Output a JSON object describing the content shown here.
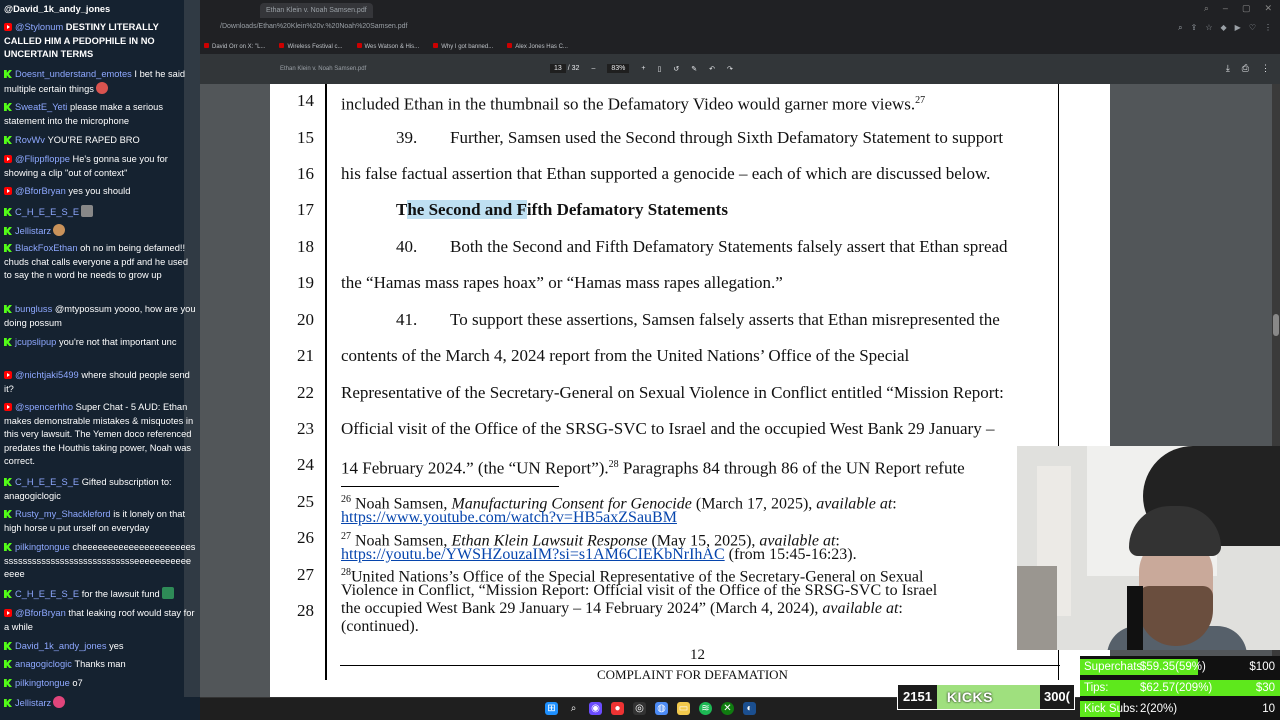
{
  "browser": {
    "tab_title": "Ethan Klein v. Noah Samsen.pdf",
    "url": "/Downloads/Ethan%20Klein%20v.%20Noah%20Samsen.pdf",
    "bookmarks": [
      "David Orr on X: \"L...",
      "Wireless Festival c...",
      "Wes Watson & His...",
      "Why I got banned...",
      "Alex Jones Has C..."
    ]
  },
  "pdf_toolbar": {
    "filename": "Ethan Klein v. Noah Samsen.pdf",
    "page_current": "13",
    "page_total": "/ 32",
    "zoom": "83%"
  },
  "document": {
    "lines": [
      {
        "n": "14",
        "text": "included Ethan in the thumbnail so the Defamatory Video would garner more views.",
        "sup": "27"
      },
      {
        "n": "15",
        "para": "39.",
        "text": "Further, Samsen used the Second through Sixth Defamatory Statement to support"
      },
      {
        "n": "16",
        "text": "his false factual assertion that Ethan supported a genocide – each of which are discussed below."
      },
      {
        "n": "17",
        "heading_pre": "T",
        "heading_hl": "he Second and F",
        "heading_post": "ifth Defamatory Statements"
      },
      {
        "n": "18",
        "para": "40.",
        "text": "Both the Second and Fifth Defamatory Statements falsely assert that Ethan spread"
      },
      {
        "n": "19",
        "text": "the “Hamas mass rapes hoax” or “Hamas mass rapes allegation.”"
      },
      {
        "n": "20",
        "para": "41.",
        "text": "To support these assertions, Samsen falsely asserts that Ethan misrepresented the"
      },
      {
        "n": "21",
        "text": "contents of the March 4, 2024 report from the United Nations’ Office of the Special"
      },
      {
        "n": "22",
        "text": "Representative of the Secretary-General on Sexual Violence in Conflict entitled “Mission Report:"
      },
      {
        "n": "23",
        "text": "Official visit of the Office of the SRSG-SVC to Israel and the occupied West Bank 29 January –"
      },
      {
        "n": "24",
        "text": "14 February 2024.” (the “UN Report”).",
        "sup": "28",
        "text2": " Paragraphs 84 through 86 of the UN Report refute"
      },
      {
        "n": "25"
      },
      {
        "n": "26"
      },
      {
        "n": "27"
      },
      {
        "n": "28"
      }
    ],
    "footnotes": [
      {
        "num": "26",
        "author": "Noah Samsen, ",
        "title": "Manufacturing Consent for Genocide",
        "rest": " (March 17, 2025), ",
        "avail": "available at",
        "colon": ":",
        "link": "https://www.youtube.com/watch?v=HB5axZSauBM",
        "after": ""
      },
      {
        "num": "27",
        "author": "Noah Samsen, ",
        "title": "Ethan Klein Lawsuit Response",
        "rest": " (May 15, 2025), ",
        "avail": "available at",
        "colon": ":",
        "link": "https://youtu.be/YWSHZouzaIM?si=s1AM6CIEKbNrIhAC",
        "after": " (from 15:45-16:23)."
      },
      {
        "num": "28",
        "line1": "United Nations’s Office of the Special Representative of the Secretary-General on Sexual",
        "line2": "Violence in Conflict, “Mission Report: Official visit of the Office of the SRSG-SVC to Israel",
        "line3a": "the occupied West Bank 29 January – 14 February 2024” (March 4, 2024), ",
        "line3b": "available at",
        "line3c": ":",
        "line4": "(continued)."
      }
    ],
    "page_number": "12",
    "footer": "COMPLAINT FOR DEFAMATION"
  },
  "chat": {
    "messages": [
      {
        "src": "kick",
        "user": "@David_1k_andy_jones",
        "text": ""
      },
      {
        "src": "yt",
        "user": "@Stylonum",
        "text": "DESTINY LITERALLY CALLED HIM A PEDOPHILE IN NO UNCERTAIN TERMS"
      },
      {
        "src": "kick",
        "user": "Doesnt_understand_emotes",
        "text": "I bet he said multiple certain things"
      },
      {
        "src": "kick",
        "user": "SweatE_Yeti",
        "text": "please make a serious statement into the microphone"
      },
      {
        "src": "kick",
        "user": "RovWv",
        "text": "YOU'RE RAPED BRO"
      },
      {
        "src": "yt",
        "user": "@Flippfloppe",
        "text": "He's gonna sue you for showing a clip \"out of context\""
      },
      {
        "src": "yt",
        "user": "@BforBryan",
        "text": "yes you should"
      },
      {
        "src": "kick",
        "user": "C_H_E_E_S_E",
        "text": ""
      },
      {
        "src": "kick",
        "user": "Jellistarz",
        "text": ""
      },
      {
        "src": "kick",
        "user": "BlackFoxEthan",
        "text": "oh no im being defamed!! chuds chat calls everyone a pdf and he used to say the n word he needs to grow up"
      },
      {
        "src": "kick",
        "user": "bungluss",
        "text": "@mtypossum yoooo, how are you doing possum"
      },
      {
        "src": "kick",
        "user": "jcupslipup",
        "text": "you're not that important unc"
      },
      {
        "src": "yt",
        "user": "@nichtjaki5499",
        "text": "where should people send it?"
      },
      {
        "src": "yt",
        "user": "@spencerhho",
        "text": "Super Chat - 5 AUD: Ethan makes demonstrable mistakes & misquotes in this very lawsuit. The Yemen doco referenced predates the Houthis taking power, Noah was correct."
      },
      {
        "src": "kick",
        "user": "C_H_E_E_S_E",
        "text": "Gifted subscription to: anagogiclogic"
      },
      {
        "src": "kick",
        "user": "Rusty_my_Shackleford",
        "text": "is it lonely on that high horse u put urself on everyday"
      },
      {
        "src": "kick",
        "user": "pilkingtongue",
        "text": "cheeeeeeeeeeeeeeeeeeeeessssssssssssssssssssssssssssseeeeeeeeeeeeeee"
      },
      {
        "src": "kick",
        "user": "C_H_E_E_S_E",
        "text": "for the lawsuit fund"
      },
      {
        "src": "yt",
        "user": "@BforBryan",
        "text": "that leaking roof would stay for a while"
      },
      {
        "src": "kick",
        "user": "David_1k_andy_jones",
        "text": "yes"
      },
      {
        "src": "kick",
        "user": "anagogiclogic",
        "text": "Thanks man"
      },
      {
        "src": "kick",
        "user": "pilkingtongue",
        "text": "o7"
      },
      {
        "src": "kick",
        "user": "Jellistarz",
        "text": ""
      }
    ]
  },
  "kicks": {
    "count": "2151",
    "label": "KICKS",
    "goal": "300("
  },
  "stats": {
    "superchats": {
      "label": "Superchats",
      "value": "$59.35(59%)",
      "goal": "$100",
      "fill": 0.59
    },
    "tips": {
      "label": "Tips:",
      "value": "$62.57(209%)",
      "goal": "$30",
      "fill": 1.0
    },
    "kick_subs": {
      "label": "Kick Subs:",
      "value": "2(20%)",
      "goal": "10",
      "fill": 0.2
    }
  },
  "colors": {
    "kick_green": "#53fc18",
    "yt_red": "#ff0000",
    "highlight": "#bfe0f2",
    "link_blue": "#0645ad"
  }
}
